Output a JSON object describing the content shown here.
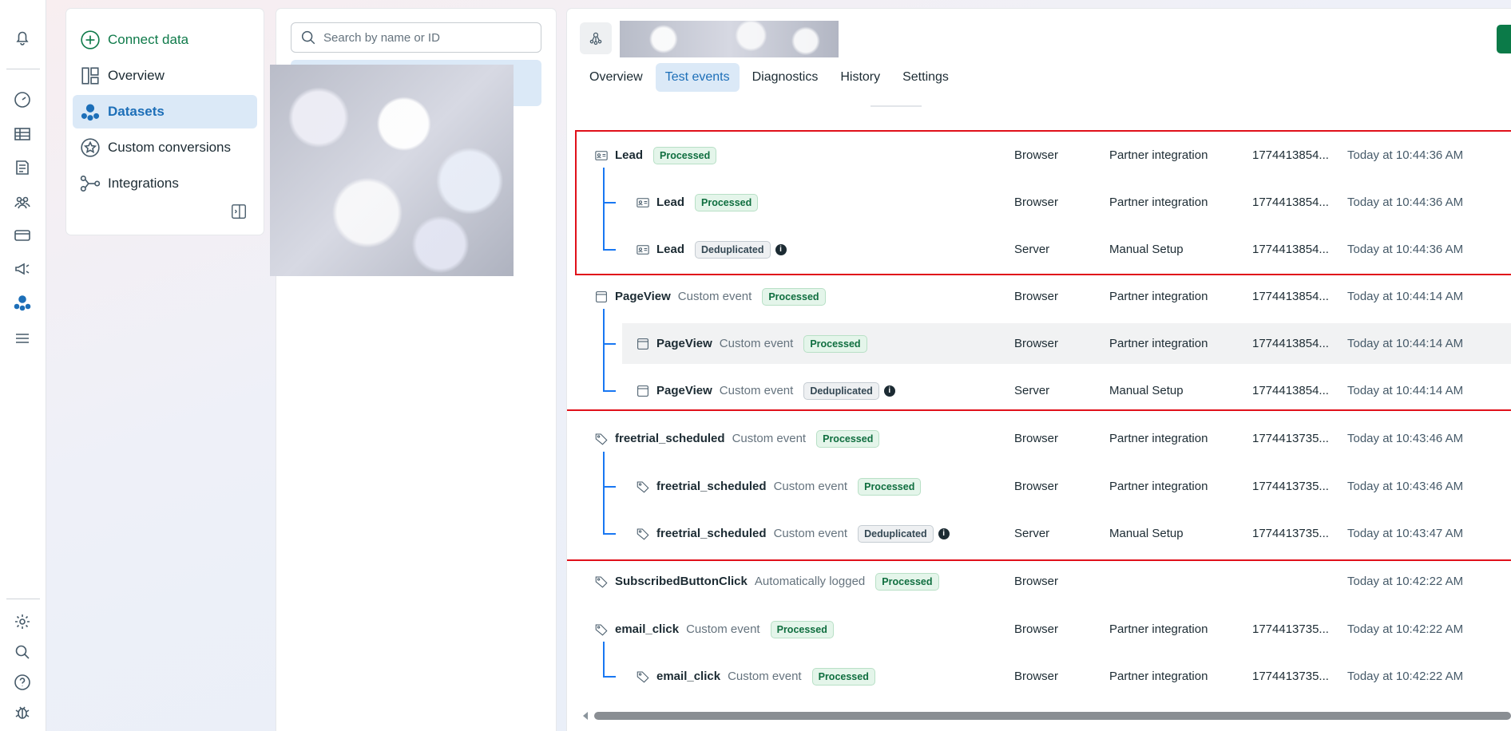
{
  "rail": {
    "icons": [
      "bell-icon",
      "speedometer-icon",
      "table-icon",
      "catalog-icon",
      "audiences-icon",
      "billing-icon",
      "ads-icon",
      "datasets-icon",
      "menu-icon",
      "settings-icon",
      "search-icon",
      "help-icon",
      "bug-icon"
    ]
  },
  "nav": {
    "connect_label": "Connect data",
    "items": [
      {
        "label": "Overview",
        "icon": "overview-icon"
      },
      {
        "label": "Datasets",
        "icon": "datasets-icon",
        "active": true
      },
      {
        "label": "Custom conversions",
        "icon": "custom-conversions-icon"
      },
      {
        "label": "Integrations",
        "icon": "integrations-icon"
      }
    ]
  },
  "search": {
    "placeholder": "Search by name or ID"
  },
  "tabs": [
    {
      "label": "Overview"
    },
    {
      "label": "Test events",
      "active": true
    },
    {
      "label": "Diagnostics"
    },
    {
      "label": "History"
    },
    {
      "label": "Settings"
    }
  ],
  "events": [
    {
      "name": "Lead",
      "type": "",
      "status": "Processed",
      "source": "Browser",
      "integration": "Partner integration",
      "event_id": "1774413854...",
      "time": "Today at 10:44:36 AM",
      "child": false,
      "icon": "id-card-icon"
    },
    {
      "name": "Lead",
      "type": "",
      "status": "Processed",
      "source": "Browser",
      "integration": "Partner integration",
      "event_id": "1774413854...",
      "time": "Today at 10:44:36 AM",
      "child": true,
      "icon": "id-card-icon"
    },
    {
      "name": "Lead",
      "type": "",
      "status": "Deduplicated",
      "source": "Server",
      "integration": "Manual Setup",
      "event_id": "1774413854...",
      "time": "Today at 10:44:36 AM",
      "child": true,
      "icon": "id-card-icon"
    },
    {
      "name": "PageView",
      "type": "Custom event",
      "status": "Processed",
      "source": "Browser",
      "integration": "Partner integration",
      "event_id": "1774413854...",
      "time": "Today at 10:44:14 AM",
      "child": false,
      "icon": "page-icon"
    },
    {
      "name": "PageView",
      "type": "Custom event",
      "status": "Processed",
      "source": "Browser",
      "integration": "Partner integration",
      "event_id": "1774413854...",
      "time": "Today at 10:44:14 AM",
      "child": true,
      "icon": "page-icon"
    },
    {
      "name": "PageView",
      "type": "Custom event",
      "status": "Deduplicated",
      "source": "Server",
      "integration": "Manual Setup",
      "event_id": "1774413854...",
      "time": "Today at 10:44:14 AM",
      "child": true,
      "icon": "page-icon"
    },
    {
      "name": "freetrial_scheduled",
      "type": "Custom event",
      "status": "Processed",
      "source": "Browser",
      "integration": "Partner integration",
      "event_id": "1774413735...",
      "time": "Today at 10:43:46 AM",
      "child": false,
      "icon": "tag-icon"
    },
    {
      "name": "freetrial_scheduled",
      "type": "Custom event",
      "status": "Processed",
      "source": "Browser",
      "integration": "Partner integration",
      "event_id": "1774413735...",
      "time": "Today at 10:43:46 AM",
      "child": true,
      "icon": "tag-icon"
    },
    {
      "name": "freetrial_scheduled",
      "type": "Custom event",
      "status": "Deduplicated",
      "source": "Server",
      "integration": "Manual Setup",
      "event_id": "1774413735...",
      "time": "Today at 10:43:47 AM",
      "child": true,
      "icon": "tag-icon"
    },
    {
      "name": "SubscribedButtonClick",
      "type": "Automatically logged",
      "status": "Processed",
      "source": "Browser",
      "integration": "",
      "event_id": "",
      "time": "Today at 10:42:22 AM",
      "child": false,
      "icon": "tag-icon"
    },
    {
      "name": "email_click",
      "type": "Custom event",
      "status": "Processed",
      "source": "Browser",
      "integration": "Partner integration",
      "event_id": "1774413735...",
      "time": "Today at 10:42:22 AM",
      "child": false,
      "icon": "tag-icon"
    },
    {
      "name": "email_click",
      "type": "Custom event",
      "status": "Processed",
      "source": "Browser",
      "integration": "Partner integration",
      "event_id": "1774413735...",
      "time": "Today at 10:42:22 AM",
      "child": true,
      "icon": "tag-icon"
    }
  ],
  "colors": {
    "accent": "#1d6fb8",
    "highlight_box": "#e0101a",
    "brand_green": "#0b7a48",
    "tree_line": "#1877f2"
  }
}
